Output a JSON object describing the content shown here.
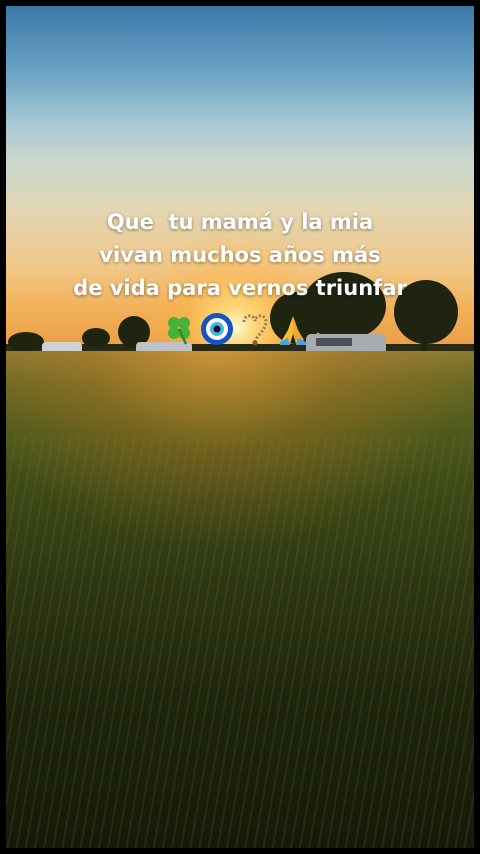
{
  "caption": {
    "line1": "Que  tu mamá y la mia",
    "line2": "vivan muchos años más",
    "line3": "de vida para vernos triunfar"
  },
  "emojis": [
    {
      "name": "four-leaf-clover-icon"
    },
    {
      "name": "nazar-amulet-icon"
    },
    {
      "name": "prayer-beads-icon"
    },
    {
      "name": "folded-hands-icon"
    }
  ],
  "colors": {
    "sky_top": "#3a78a8",
    "horizon": "#e8953c",
    "grass_dark": "#1e250d",
    "caption": "#ffffff"
  }
}
